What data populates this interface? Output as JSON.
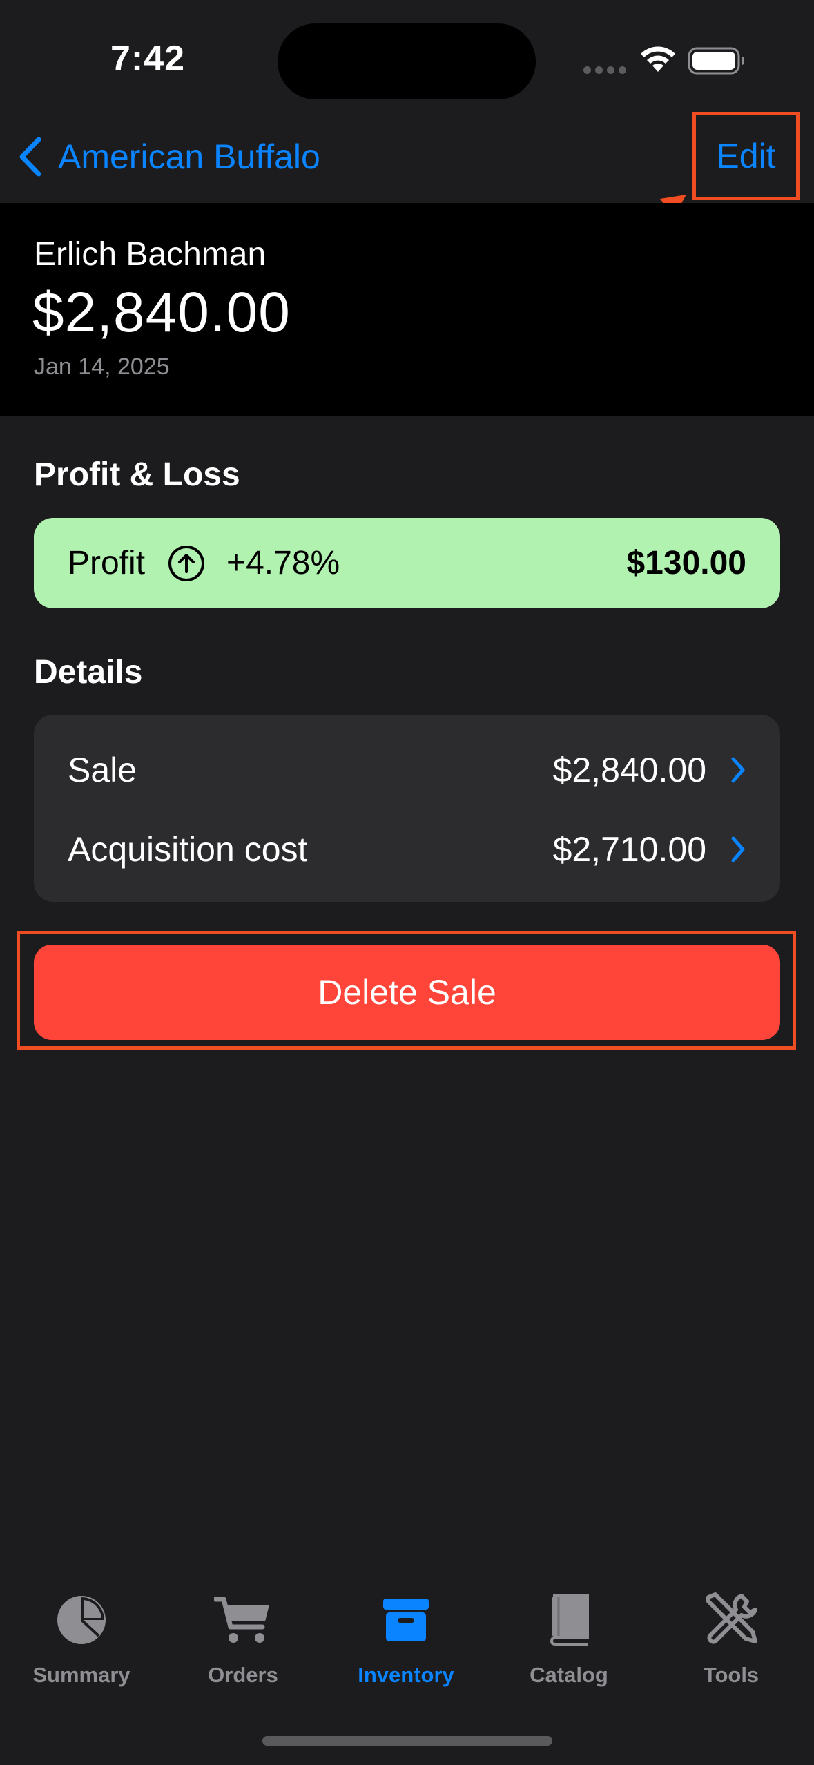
{
  "status_bar": {
    "time": "7:42"
  },
  "nav": {
    "back_label": "American Buffalo",
    "edit_label": "Edit"
  },
  "sale": {
    "customer": "Erlich Bachman",
    "amount": "$2,840.00",
    "date": "Jan 14, 2025"
  },
  "profit_loss": {
    "section_title": "Profit & Loss",
    "label": "Profit",
    "percent": "+4.78%",
    "value": "$130.00",
    "icon": "arrow-up-circle-icon",
    "color": "#b2f2b1"
  },
  "details": {
    "section_title": "Details",
    "rows": [
      {
        "label": "Sale",
        "value": "$2,840.00"
      },
      {
        "label": "Acquisition cost",
        "value": "$2,710.00"
      }
    ]
  },
  "delete_label": "Delete Sale",
  "tabs": [
    {
      "label": "Summary",
      "icon": "pie-chart-icon",
      "active": false
    },
    {
      "label": "Orders",
      "icon": "cart-icon",
      "active": false
    },
    {
      "label": "Inventory",
      "icon": "archive-box-icon",
      "active": true
    },
    {
      "label": "Catalog",
      "icon": "book-icon",
      "active": false
    },
    {
      "label": "Tools",
      "icon": "tools-icon",
      "active": false
    }
  ],
  "colors": {
    "accent": "#0a84ff",
    "destructive": "#ff453a",
    "annotation": "#f04d23",
    "background": "#1c1c1e"
  }
}
